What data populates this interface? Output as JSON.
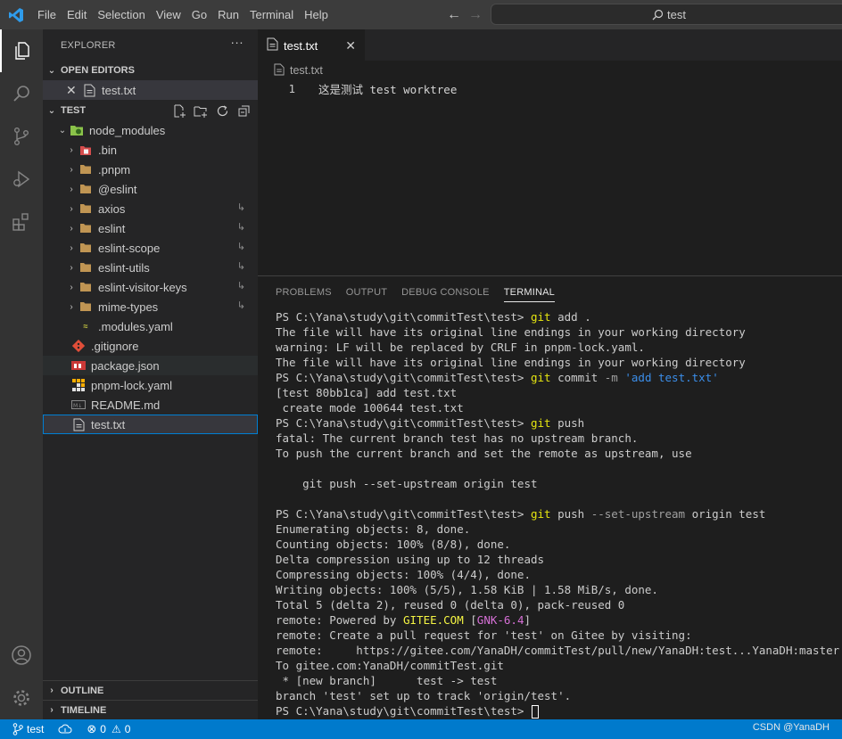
{
  "menu": [
    "File",
    "Edit",
    "Selection",
    "View",
    "Go",
    "Run",
    "Terminal",
    "Help"
  ],
  "search": {
    "text": "test"
  },
  "sidebar": {
    "title": "EXPLORER",
    "open_editors": {
      "header": "OPEN EDITORS",
      "items": [
        {
          "name": "test.txt"
        }
      ]
    },
    "project": {
      "header": "TEST",
      "tree": [
        {
          "name": "node_modules",
          "kind": "folder-open"
        },
        {
          "name": ".bin",
          "kind": "folder"
        },
        {
          "name": ".pnpm",
          "kind": "folder"
        },
        {
          "name": "@eslint",
          "kind": "folder"
        },
        {
          "name": "axios",
          "kind": "folder"
        },
        {
          "name": "eslint",
          "kind": "folder"
        },
        {
          "name": "eslint-scope",
          "kind": "folder"
        },
        {
          "name": "eslint-utils",
          "kind": "folder"
        },
        {
          "name": "eslint-visitor-keys",
          "kind": "folder"
        },
        {
          "name": "mime-types",
          "kind": "folder"
        },
        {
          "name": ".modules.yaml",
          "kind": "yaml"
        },
        {
          "name": ".gitignore",
          "kind": "git"
        },
        {
          "name": "package.json",
          "kind": "npm"
        },
        {
          "name": "pnpm-lock.yaml",
          "kind": "pnpm"
        },
        {
          "name": "README.md",
          "kind": "md"
        },
        {
          "name": "test.txt",
          "kind": "txt"
        }
      ]
    },
    "outline_header": "OUTLINE",
    "timeline_header": "TIMELINE"
  },
  "editor": {
    "tab_label": "test.txt",
    "breadcrumb": "test.txt",
    "lines": [
      {
        "number": "1",
        "text": "这是测试 test worktree"
      }
    ]
  },
  "panel": {
    "tabs": [
      "PROBLEMS",
      "OUTPUT",
      "DEBUG CONSOLE",
      "TERMINAL"
    ],
    "active_tab": "TERMINAL",
    "terminal_lines": [
      [
        {
          "t": "PS C:\\Yana\\study\\git\\commitTest\\test> "
        },
        {
          "t": "git",
          "c": "c-yellow"
        },
        {
          "t": " add ."
        }
      ],
      [
        {
          "t": "The file will have its original line endings in your working directory"
        }
      ],
      [
        {
          "t": "warning: LF will be replaced by CRLF in pnpm-lock.yaml."
        }
      ],
      [
        {
          "t": "The file will have its original line endings in your working directory"
        }
      ],
      [
        {
          "t": "PS C:\\Yana\\study\\git\\commitTest\\test> "
        },
        {
          "t": "git",
          "c": "c-yellow"
        },
        {
          "t": " commit "
        },
        {
          "t": "-m",
          "c": "c-gray"
        },
        {
          "t": " "
        },
        {
          "t": "'add test.txt'",
          "c": "c-str"
        }
      ],
      [
        {
          "t": "[test 80bb1ca] add test.txt"
        }
      ],
      [
        {
          "t": " create mode 100644 test.txt"
        }
      ],
      [
        {
          "t": "PS C:\\Yana\\study\\git\\commitTest\\test> "
        },
        {
          "t": "git",
          "c": "c-yellow"
        },
        {
          "t": " push"
        }
      ],
      [
        {
          "t": "fatal: The current branch test has no upstream branch."
        }
      ],
      [
        {
          "t": "To push the current branch and set the remote as upstream, use"
        }
      ],
      [
        {
          "t": ""
        }
      ],
      [
        {
          "t": "    git push --set-upstream origin test"
        }
      ],
      [
        {
          "t": ""
        }
      ],
      [
        {
          "t": "PS C:\\Yana\\study\\git\\commitTest\\test> "
        },
        {
          "t": "git",
          "c": "c-yellow"
        },
        {
          "t": " push "
        },
        {
          "t": "--set-upstream",
          "c": "c-gray"
        },
        {
          "t": " origin test"
        }
      ],
      [
        {
          "t": "Enumerating objects: 8, done."
        }
      ],
      [
        {
          "t": "Counting objects: 100% (8/8), done."
        }
      ],
      [
        {
          "t": "Delta compression using up to 12 threads"
        }
      ],
      [
        {
          "t": "Compressing objects: 100% (4/4), done."
        }
      ],
      [
        {
          "t": "Writing objects: 100% (5/5), 1.58 KiB | 1.58 MiB/s, done."
        }
      ],
      [
        {
          "t": "Total 5 (delta 2), reused 0 (delta 0), pack-reused 0"
        }
      ],
      [
        {
          "t": "remote: Powered by "
        },
        {
          "t": "GITEE.COM",
          "c": "c-bright-yellow"
        },
        {
          "t": " ["
        },
        {
          "t": "GNK-6.4",
          "c": "c-magenta"
        },
        {
          "t": "]"
        }
      ],
      [
        {
          "t": "remote: Create a pull request for 'test' on Gitee by visiting:"
        }
      ],
      [
        {
          "t": "remote:     https://gitee.com/YanaDH/commitTest/pull/new/YanaDH:test...YanaDH:master"
        }
      ],
      [
        {
          "t": "To gitee.com:YanaDH/commitTest.git"
        }
      ],
      [
        {
          "t": " * [new branch]      test -> test"
        }
      ],
      [
        {
          "t": "branch 'test' set up to track 'origin/test'."
        }
      ],
      [
        {
          "t": "PS C:\\Yana\\study\\git\\commitTest\\test> "
        },
        {
          "t": "",
          "cursor": true
        }
      ]
    ]
  },
  "statusbar": {
    "branch": "test",
    "errors": "0",
    "warnings": "0",
    "watermark": "CSDN @YanaDH"
  },
  "colors": {
    "statusbar_bg": "#007acc",
    "activity_bg": "#333333",
    "sidebar_bg": "#252526",
    "editor_bg": "#1e1e1e",
    "titlebar_bg": "#3c3c3c"
  }
}
